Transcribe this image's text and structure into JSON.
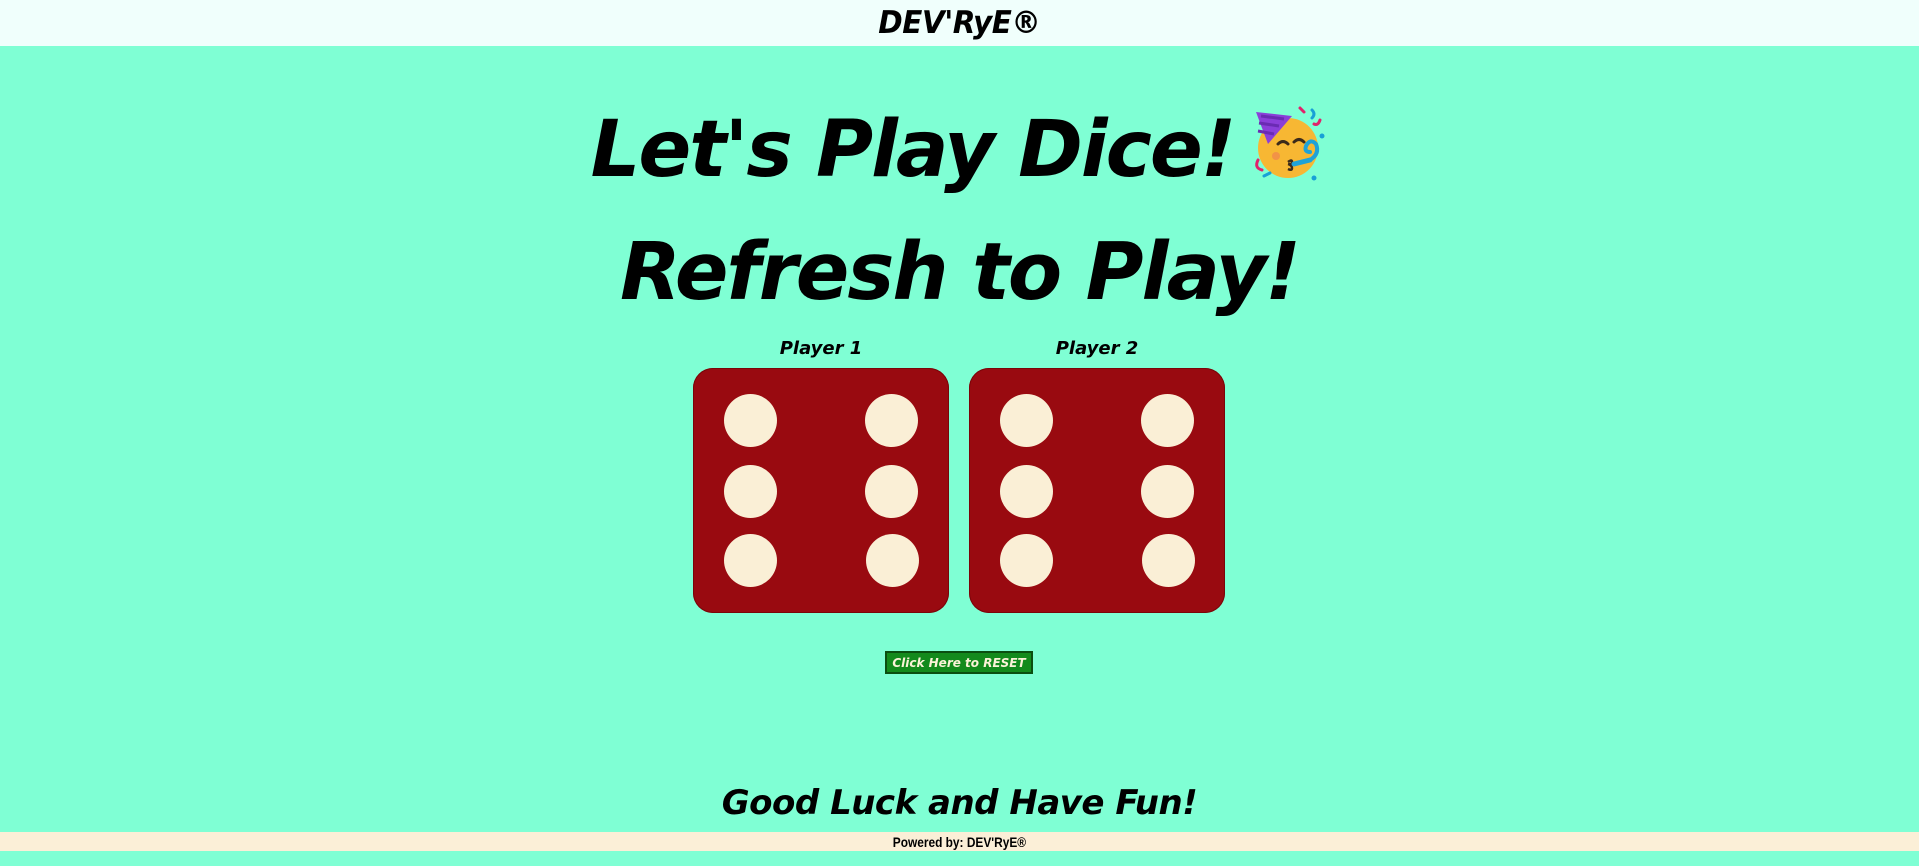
{
  "header": {
    "brand": "DEV'RyE®"
  },
  "main": {
    "title": "Let's Play Dice!",
    "title_emoji": "partying-face-icon",
    "subtitle": "Refresh to Play!",
    "players": [
      {
        "label": "Player 1",
        "die_value": 6
      },
      {
        "label": "Player 2",
        "die_value": 6
      }
    ],
    "reset_label": "Click Here to RESET",
    "closing": "Good Luck and Have Fun!"
  },
  "footer": {
    "powered_by": "Powered by: DEV'RyE®"
  },
  "colors": {
    "background": "#7fffd4",
    "header_bg": "#f0fffc",
    "die_face": "#990a10",
    "pip": "#faefd6",
    "reset_button": "#138a1c",
    "footer_bg": "#fbefd7"
  }
}
